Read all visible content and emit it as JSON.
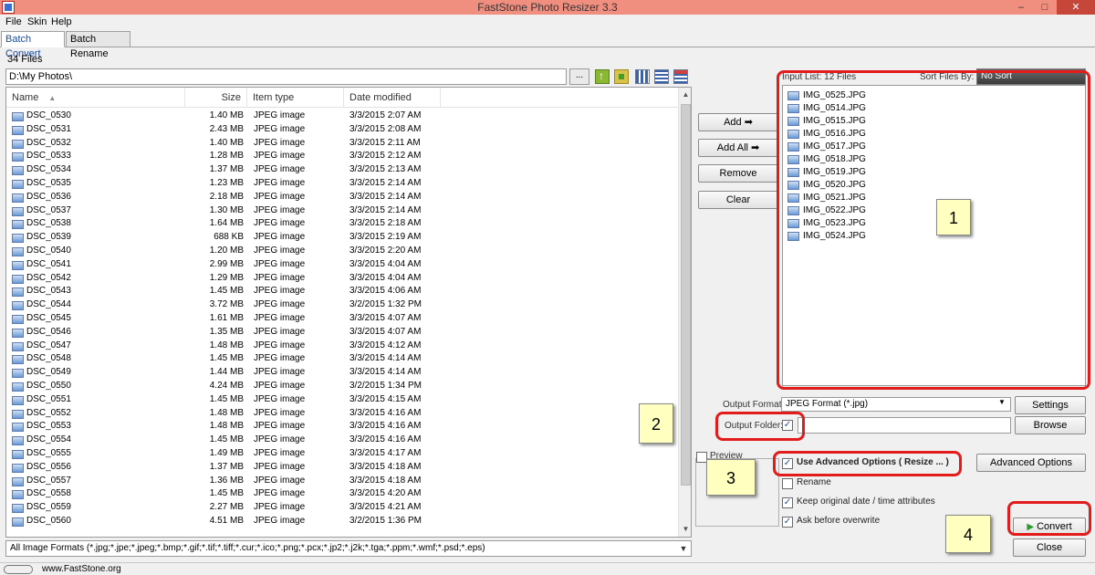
{
  "window": {
    "title": "FastStone Photo Resizer 3.3",
    "minimize": "–",
    "maximize": "□",
    "close": "✕"
  },
  "menu": [
    "File",
    "Skin",
    "Help"
  ],
  "tabs": [
    "Batch Convert",
    "Batch Rename"
  ],
  "file_count": "34 Files",
  "path": "D:\\My Photos\\",
  "browse_path_label": "...",
  "columns": {
    "name": "Name",
    "sort_indicator": "▲",
    "size": "Size",
    "type": "Item type",
    "date": "Date modified"
  },
  "files": [
    {
      "name": "DSC_0530",
      "size": "1.40 MB",
      "type": "JPEG image",
      "date": "3/3/2015 2:07 AM"
    },
    {
      "name": "DSC_0531",
      "size": "2.43 MB",
      "type": "JPEG image",
      "date": "3/3/2015 2:08 AM"
    },
    {
      "name": "DSC_0532",
      "size": "1.40 MB",
      "type": "JPEG image",
      "date": "3/3/2015 2:11 AM"
    },
    {
      "name": "DSC_0533",
      "size": "1.28 MB",
      "type": "JPEG image",
      "date": "3/3/2015 2:12 AM"
    },
    {
      "name": "DSC_0534",
      "size": "1.37 MB",
      "type": "JPEG image",
      "date": "3/3/2015 2:13 AM"
    },
    {
      "name": "DSC_0535",
      "size": "1.23 MB",
      "type": "JPEG image",
      "date": "3/3/2015 2:14 AM"
    },
    {
      "name": "DSC_0536",
      "size": "2.18 MB",
      "type": "JPEG image",
      "date": "3/3/2015 2:14 AM"
    },
    {
      "name": "DSC_0537",
      "size": "1.30 MB",
      "type": "JPEG image",
      "date": "3/3/2015 2:14 AM"
    },
    {
      "name": "DSC_0538",
      "size": "1.64 MB",
      "type": "JPEG image",
      "date": "3/3/2015 2:18 AM"
    },
    {
      "name": "DSC_0539",
      "size": "688 KB",
      "type": "JPEG image",
      "date": "3/3/2015 2:19 AM"
    },
    {
      "name": "DSC_0540",
      "size": "1.20 MB",
      "type": "JPEG image",
      "date": "3/3/2015 2:20 AM"
    },
    {
      "name": "DSC_0541",
      "size": "2.99 MB",
      "type": "JPEG image",
      "date": "3/3/2015 4:04 AM"
    },
    {
      "name": "DSC_0542",
      "size": "1.29 MB",
      "type": "JPEG image",
      "date": "3/3/2015 4:04 AM"
    },
    {
      "name": "DSC_0543",
      "size": "1.45 MB",
      "type": "JPEG image",
      "date": "3/3/2015 4:06 AM"
    },
    {
      "name": "DSC_0544",
      "size": "3.72 MB",
      "type": "JPEG image",
      "date": "3/2/2015 1:32 PM"
    },
    {
      "name": "DSC_0545",
      "size": "1.61 MB",
      "type": "JPEG image",
      "date": "3/3/2015 4:07 AM"
    },
    {
      "name": "DSC_0546",
      "size": "1.35 MB",
      "type": "JPEG image",
      "date": "3/3/2015 4:07 AM"
    },
    {
      "name": "DSC_0547",
      "size": "1.48 MB",
      "type": "JPEG image",
      "date": "3/3/2015 4:12 AM"
    },
    {
      "name": "DSC_0548",
      "size": "1.45 MB",
      "type": "JPEG image",
      "date": "3/3/2015 4:14 AM"
    },
    {
      "name": "DSC_0549",
      "size": "1.44 MB",
      "type": "JPEG image",
      "date": "3/3/2015 4:14 AM"
    },
    {
      "name": "DSC_0550",
      "size": "4.24 MB",
      "type": "JPEG image",
      "date": "3/2/2015 1:34 PM"
    },
    {
      "name": "DSC_0551",
      "size": "1.45 MB",
      "type": "JPEG image",
      "date": "3/3/2015 4:15 AM"
    },
    {
      "name": "DSC_0552",
      "size": "1.48 MB",
      "type": "JPEG image",
      "date": "3/3/2015 4:16 AM"
    },
    {
      "name": "DSC_0553",
      "size": "1.48 MB",
      "type": "JPEG image",
      "date": "3/3/2015 4:16 AM"
    },
    {
      "name": "DSC_0554",
      "size": "1.45 MB",
      "type": "JPEG image",
      "date": "3/3/2015 4:16 AM"
    },
    {
      "name": "DSC_0555",
      "size": "1.49 MB",
      "type": "JPEG image",
      "date": "3/3/2015 4:17 AM"
    },
    {
      "name": "DSC_0556",
      "size": "1.37 MB",
      "type": "JPEG image",
      "date": "3/3/2015 4:18 AM"
    },
    {
      "name": "DSC_0557",
      "size": "1.36 MB",
      "type": "JPEG image",
      "date": "3/3/2015 4:18 AM"
    },
    {
      "name": "DSC_0558",
      "size": "1.45 MB",
      "type": "JPEG image",
      "date": "3/3/2015 4:20 AM"
    },
    {
      "name": "DSC_0559",
      "size": "2.27 MB",
      "type": "JPEG image",
      "date": "3/3/2015 4:21 AM"
    },
    {
      "name": "DSC_0560",
      "size": "4.51 MB",
      "type": "JPEG image",
      "date": "3/2/2015 1:36 PM"
    }
  ],
  "filter": "All Image Formats (*.jpg;*.jpe;*.jpeg;*.bmp;*.gif;*.tif;*.tiff;*.cur;*.ico;*.png;*.pcx;*.jp2;*.j2k;*.tga;*.ppm;*.wmf;*.psd;*.eps)",
  "scroll": {
    "up": "▲",
    "down": "▼",
    "dropdown": "▼"
  },
  "buttons": {
    "add": "Add ➡",
    "add_all": "Add All ➡",
    "remove": "Remove",
    "clear": "Clear",
    "settings": "Settings",
    "browse": "Browse",
    "advanced_options": "Advanced Options",
    "convert": "Convert",
    "close": "Close"
  },
  "input_list": {
    "label": "Input List:  12 Files",
    "sort_label": "Sort Files By:",
    "sort_value": "No Sort",
    "files": [
      "IMG_0525.JPG",
      "IMG_0514.JPG",
      "IMG_0515.JPG",
      "IMG_0516.JPG",
      "IMG_0517.JPG",
      "IMG_0518.JPG",
      "IMG_0519.JPG",
      "IMG_0520.JPG",
      "IMG_0521.JPG",
      "IMG_0522.JPG",
      "IMG_0523.JPG",
      "IMG_0524.JPG"
    ]
  },
  "output": {
    "format_label": "Output Format:",
    "format_value": "JPEG Format (*.jpg)",
    "folder_label": "Output Folder:",
    "folder_checked": "✓",
    "folder_value": ""
  },
  "options": {
    "preview": "Preview",
    "advanced": "Use Advanced Options ( Resize ... )",
    "rename": "Rename",
    "keep_date": "Keep original date / time attributes",
    "ask_overwrite": "Ask before overwrite",
    "check_mark": "✓"
  },
  "callouts": [
    "1",
    "2",
    "3",
    "4"
  ],
  "status": {
    "website": "www.FastStone.org"
  },
  "colors": {
    "titlebar": "#f08f80",
    "annotation_red": "#e31b1b",
    "callout_bg": "#ffffc0",
    "convert_green": "#2a9a2a"
  }
}
